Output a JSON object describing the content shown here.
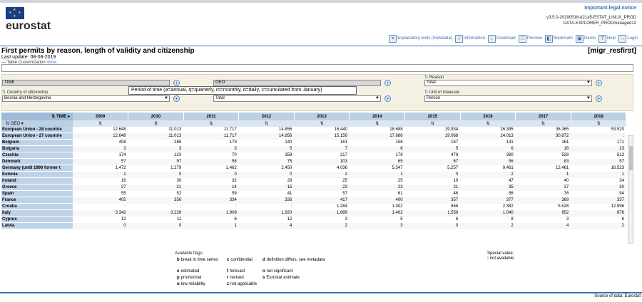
{
  "header": {
    "logo_text": "eurostat",
    "legal_link": "Important legal notice",
    "version_line1": "v3.5.0-20190516-d21a5-ESTAT_LINUX_PROD",
    "version_line2": "DATA-EXPLORER_PRODmanaged12"
  },
  "toolbar": [
    {
      "label": "Explanatory texts (metadata)",
      "icon": "document-icon"
    },
    {
      "label": "Information",
      "icon": "info-icon"
    },
    {
      "label": "Download",
      "icon": "download-icon"
    },
    {
      "label": "Preview",
      "icon": "preview-icon"
    },
    {
      "label": "Bookmark",
      "icon": "bookmark-icon"
    },
    {
      "label": "Demo",
      "icon": "demo-icon"
    },
    {
      "label": "Help",
      "icon": "help-icon"
    },
    {
      "label": "Login",
      "icon": "login-icon"
    }
  ],
  "page": {
    "title": "First permits by reason, length of validity and citizenship",
    "code": "[migr_resfirst]",
    "last_update": "Last update: 08-08-2019",
    "table_customization": "Table Customization",
    "show_link": "show"
  },
  "filters": {
    "time_value": "TIME",
    "geo_value": "GEO",
    "reason_label": "Reason",
    "reason_value": "Total",
    "citizenship_label": "Country of citizenship",
    "citizenship_value": "Bosnia and Herzegovina",
    "duration_value": "Total",
    "unit_label": "Unit of measure",
    "unit_value": "Person",
    "tooltip": "Period of time (a=annual, q=quarterly, m=monthly, d=daily, c=cumulated from January)"
  },
  "table": {
    "time_header": "TIME",
    "geo_header": "GEO",
    "years": [
      "2009",
      "2010",
      "2011",
      "2012",
      "2013",
      "2014",
      "2015",
      "2016",
      "2017",
      "2018"
    ],
    "rows": [
      {
        "geo": "European Union - 28 countrie",
        "values": [
          "12.648",
          "11.013",
          "11.717",
          "14.856",
          "16.440",
          "18.688",
          "19.934",
          "26.395",
          "36.365",
          "53.520"
        ]
      },
      {
        "geo": "European Union - 27 countrie",
        "values": [
          "12.648",
          "11.013",
          "11.717",
          "14.856",
          "15.156",
          "17.686",
          "19.068",
          "24.013",
          "30.872",
          ":"
        ]
      },
      {
        "geo": "Belgium",
        "values": [
          "408",
          "286",
          "179",
          "140",
          "161",
          "156",
          "167",
          "131",
          "161",
          "171"
        ]
      },
      {
        "geo": "Bulgaria",
        "values": [
          "3",
          "3",
          "3",
          "5",
          "7",
          "6",
          "5",
          "6",
          "16",
          "23"
        ]
      },
      {
        "geo": "Czechia",
        "values": [
          "174",
          "123",
          "70",
          "359",
          "217",
          "179",
          "479",
          "390",
          "528",
          "513"
        ]
      },
      {
        "geo": "Denmark",
        "values": [
          "57",
          "97",
          "58",
          "75",
          "103",
          "65",
          "67",
          "56",
          "83",
          "57"
        ]
      },
      {
        "geo": "Germany (until 1990 former t",
        "values": [
          "1.472",
          "1.279",
          "1.462",
          "2.450",
          "4.036",
          "5.347",
          "5.257",
          "9.461",
          "12.461",
          "16.523"
        ]
      },
      {
        "geo": "Estonia",
        "values": [
          "1",
          "0",
          "0",
          "0",
          "2",
          "1",
          "0",
          "2",
          "1",
          "1"
        ]
      },
      {
        "geo": "Ireland",
        "values": [
          "16",
          "30",
          "32",
          "28",
          "25",
          "25",
          "19",
          "47",
          "40",
          "34"
        ]
      },
      {
        "geo": "Greece",
        "values": [
          "27",
          "21",
          "14",
          "15",
          "23",
          "23",
          "21",
          "35",
          "37",
          "30"
        ]
      },
      {
        "geo": "Spain",
        "values": [
          "55",
          "52",
          "59",
          "41",
          "57",
          "61",
          "46",
          "56",
          "76",
          "94"
        ]
      },
      {
        "geo": "France",
        "values": [
          "405",
          "356",
          "334",
          "326",
          "417",
          "400",
          "357",
          "377",
          "369",
          "337"
        ]
      },
      {
        "geo": "Croatia",
        "values": [
          ":",
          ":",
          ":",
          ":",
          "1.284",
          "1.002",
          "866",
          "2.382",
          "5.526",
          "12.996"
        ]
      },
      {
        "geo": "Italy",
        "values": [
          "3.342",
          "3.226",
          "1.908",
          "1.920",
          "1.689",
          "1.402",
          "1.556",
          "1.040",
          "952",
          "976"
        ]
      },
      {
        "geo": "Cyprus",
        "values": [
          "12",
          "11",
          "6",
          "12",
          "3",
          "5",
          "6",
          "8",
          "3",
          "6"
        ]
      },
      {
        "geo": "Latvia",
        "values": [
          "0",
          "0",
          "1",
          "4",
          "2",
          "3",
          "0",
          "2",
          "4",
          "2"
        ]
      }
    ]
  },
  "flags": {
    "title": "Available flags:",
    "items": [
      {
        "code": "b",
        "text": "break in time series"
      },
      {
        "code": "c",
        "text": "confidential"
      },
      {
        "code": "d",
        "text": "definition differs, see metadata"
      },
      {
        "code": "e",
        "text": "estimated"
      },
      {
        "code": "f",
        "text": "forecast"
      },
      {
        "code": "n",
        "text": "not significant"
      },
      {
        "code": "p",
        "text": "provisional"
      },
      {
        "code": "r",
        "text": "revised"
      },
      {
        "code": "s",
        "text": "Eurostat estimate"
      },
      {
        "code": "u",
        "text": "low reliability"
      },
      {
        "code": "z",
        "text": "not applicable"
      }
    ],
    "special_title": "Special value:",
    "special_code": ":",
    "special_text": "not available"
  },
  "footer": {
    "source": "Source of data: Eurostat"
  }
}
